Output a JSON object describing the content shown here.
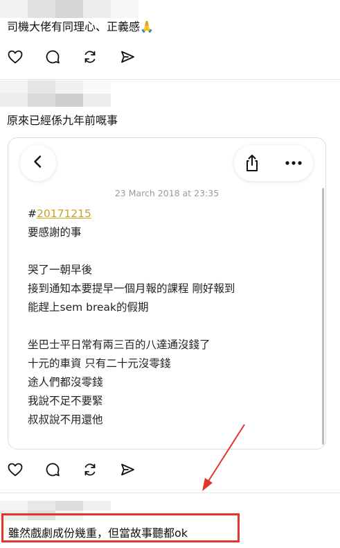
{
  "posts": [
    {
      "author": "",
      "text": "司機大佬有同理心、正義感🙏"
    },
    {
      "author": "",
      "text": "原來已經係九年前嘅事",
      "attachment": {
        "date": "23 March 2018 at 23:35",
        "hashtag_symbol": "#",
        "hashtag": "20171215",
        "lines": [
          "要感謝的事",
          "",
          "哭了一朝早後",
          "接到通知本要提早一個月報的課程 剛好報到",
          "能趕上sem break的假期",
          "",
          "坐巴士平日常有兩三百的八達通沒錢了",
          "十元的車資 只有二十元沒零錢",
          "途人們都沒零錢",
          "我說不足不要緊",
          "叔叔說不用還他"
        ]
      }
    },
    {
      "author": "",
      "text": "雖然戲劇成份幾重，但當故事聽都ok"
    }
  ],
  "icons": [
    "heart-icon",
    "comment-icon",
    "repost-icon",
    "share-icon",
    "back-icon",
    "upload-icon",
    "more-icon",
    "arrow-annotation"
  ],
  "colors": {
    "annotation": "#e5332a",
    "hashtag": "#c9a322"
  }
}
